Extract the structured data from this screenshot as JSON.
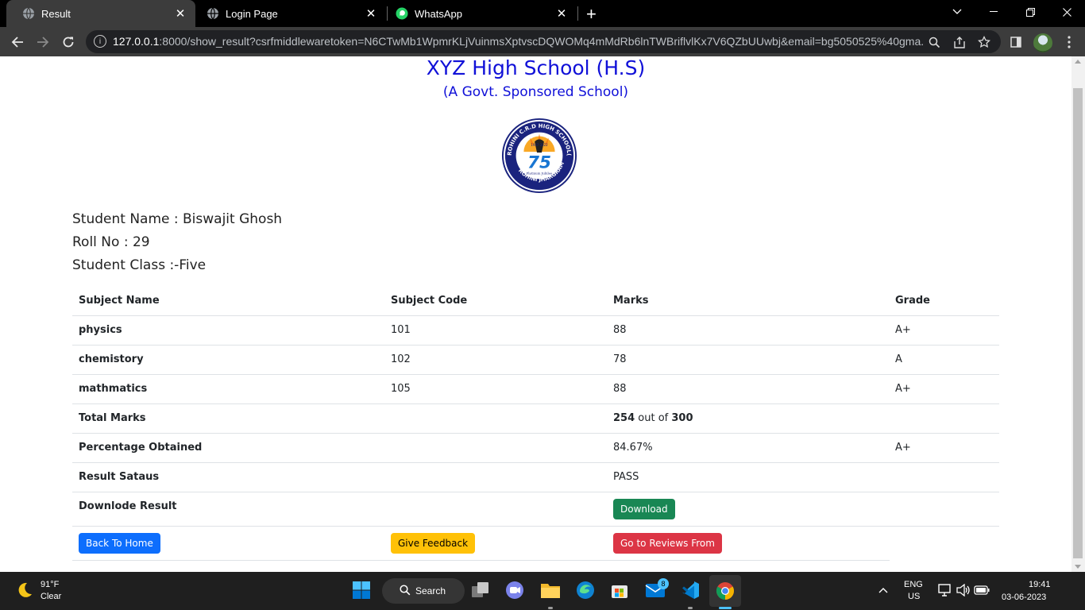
{
  "browser": {
    "tabs": [
      {
        "title": "Result",
        "icon": "globe-icon"
      },
      {
        "title": "Login Page",
        "icon": "globe-icon"
      },
      {
        "title": "WhatsApp",
        "icon": "whatsapp-icon"
      }
    ],
    "new_tab": "+",
    "url_host": "127.0.0.1",
    "url_rest": ":8000/show_result?csrfmiddlewaretoken=N6CTwMb1WpmrKLjVuinmsXptvscDQWOMq4mMdRb6lnTWBriflvlKx7V6QZbUUwbj&email=bg5050525%40gma..."
  },
  "school": {
    "name": "XYZ High School (H.S)",
    "subtitle": "(A Govt. Sponsored School)",
    "logo": {
      "top_text": "ROHINI C.R.D HIGH SCHOOL(H.S)",
      "bottom_text": "ROHINI  JHARGRAM",
      "number": "75",
      "caption": "Platinum Jubilee",
      "years": "1947-2022"
    }
  },
  "student": {
    "name_label": "Student Name : Biswajit Ghosh",
    "roll_label": "Roll No : 29",
    "class_label": "Student Class :-Five"
  },
  "table": {
    "headers": [
      "Subject Name",
      "Subject Code",
      "Marks",
      "Grade"
    ],
    "subjects": [
      {
        "name": "physics",
        "code": "101",
        "marks": "88",
        "grade": "A+"
      },
      {
        "name": "chemistory",
        "code": "102",
        "marks": "78",
        "grade": "A"
      },
      {
        "name": "mathmatics",
        "code": "105",
        "marks": "88",
        "grade": "A+"
      }
    ],
    "total_label": "Total Marks",
    "total_obtained": "254",
    "total_out_of": "out of",
    "total_max": "300",
    "percentage_label": "Percentage Obtained",
    "percentage_value": "84.67%",
    "percentage_grade": "A+",
    "status_label": "Result Sataus",
    "status_value": "PASS",
    "download_label": "Downlode Result",
    "download_button": "Download"
  },
  "actions": {
    "back_home": "Back To Home",
    "feedback": "Give Feedback",
    "reviews": "Go to Reviews From"
  },
  "taskbar": {
    "weather_temp": "91°F",
    "weather_desc": "Clear",
    "search_label": "Search",
    "mail_badge": "8",
    "lang_top": "ENG",
    "lang_bottom": "US",
    "time": "19:41",
    "date": "03-06-2023"
  },
  "colors": {
    "school_title": "#1010d8",
    "btn_green": "#198754",
    "btn_blue": "#0d6efd",
    "btn_yellow": "#ffc107",
    "btn_red": "#dc3545"
  }
}
